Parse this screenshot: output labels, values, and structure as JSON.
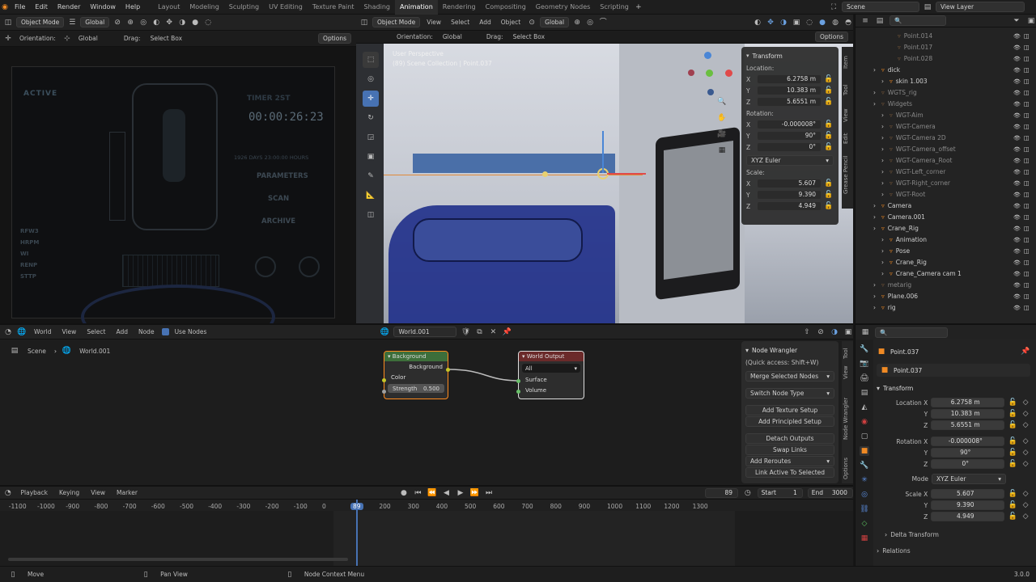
{
  "topbar": {
    "menus": [
      "File",
      "Edit",
      "Render",
      "Window",
      "Help"
    ],
    "workspaces": [
      "Layout",
      "Modeling",
      "Sculpting",
      "UV Editing",
      "Texture Paint",
      "Shading",
      "Animation",
      "Rendering",
      "Compositing",
      "Geometry Nodes",
      "Scripting"
    ],
    "active_workspace": "Animation",
    "scene": "Scene",
    "view_layer": "View Layer"
  },
  "left_viewport": {
    "mode": "Object Mode",
    "transform": "Global",
    "orientation_label": "Orientation:",
    "orientation": "Global",
    "drag_label": "Drag:",
    "drag": "Select Box",
    "options": "Options",
    "hud": {
      "timer_label": "TIMER 2ST",
      "timer": "00:00:26:23",
      "status": "ACTIVE",
      "days": "1926 DAYS 23:00:00 HOURS",
      "menu": [
        "PARAMETERS",
        "SCAN",
        "ARCHIVE"
      ],
      "stats": [
        "RFW3",
        "HRPM",
        "WI",
        "RENP",
        "STTP"
      ]
    }
  },
  "main_viewport": {
    "mode": "Object Mode",
    "menus": [
      "View",
      "Select",
      "Add",
      "Object"
    ],
    "transform": "Global",
    "orientation_label": "Orientation:",
    "orientation": "Global",
    "drag_label": "Drag:",
    "drag": "Select Box",
    "options": "Options",
    "view_name": "User Perspective",
    "collection": "(89) Scene Collection | Point.037"
  },
  "n_panel": {
    "title": "Transform",
    "location_label": "Location:",
    "location": {
      "x": "6.2758 m",
      "y": "10.383 m",
      "z": "5.6551 m"
    },
    "rotation_label": "Rotation:",
    "rotation": {
      "x": "-0.000008°",
      "y": "90°",
      "z": "0°"
    },
    "rotation_mode": "XYZ Euler",
    "scale_label": "Scale:",
    "scale": {
      "x": "5.607",
      "y": "9.390",
      "z": "4.949"
    },
    "tabs": [
      "Item",
      "Tool",
      "View",
      "Edit",
      "Grease Pencil"
    ]
  },
  "outliner": {
    "items": [
      {
        "label": "Point.014",
        "indent": 3,
        "dim": true
      },
      {
        "label": "Point.017",
        "indent": 3,
        "dim": true
      },
      {
        "label": "Point.028",
        "indent": 3,
        "dim": true
      },
      {
        "label": "dick",
        "indent": 1,
        "dim": false
      },
      {
        "label": "skin 1.003",
        "indent": 2,
        "dim": false
      },
      {
        "label": "WGTS_rig",
        "indent": 1,
        "dim": true
      },
      {
        "label": "Widgets",
        "indent": 1,
        "dim": true
      },
      {
        "label": "WGT-Aim",
        "indent": 2,
        "dim": true
      },
      {
        "label": "WGT-Camera",
        "indent": 2,
        "dim": true
      },
      {
        "label": "WGT-Camera 2D",
        "indent": 2,
        "dim": true
      },
      {
        "label": "WGT-Camera_offset",
        "indent": 2,
        "dim": true
      },
      {
        "label": "WGT-Camera_Root",
        "indent": 2,
        "dim": true
      },
      {
        "label": "WGT-Left_corner",
        "indent": 2,
        "dim": true
      },
      {
        "label": "WGT-Right_corner",
        "indent": 2,
        "dim": true
      },
      {
        "label": "WGT-Root",
        "indent": 2,
        "dim": true
      },
      {
        "label": "Camera",
        "indent": 1,
        "dim": false
      },
      {
        "label": "Camera.001",
        "indent": 1,
        "dim": false
      },
      {
        "label": "Crane_Rig",
        "indent": 1,
        "dim": false
      },
      {
        "label": "Animation",
        "indent": 2,
        "dim": false
      },
      {
        "label": "Pose",
        "indent": 2,
        "dim": false
      },
      {
        "label": "Crane_Rig",
        "indent": 2,
        "dim": false
      },
      {
        "label": "Crane_Camera cam 1",
        "indent": 2,
        "dim": false
      },
      {
        "label": "metarig",
        "indent": 1,
        "dim": true
      },
      {
        "label": "Plane.006",
        "indent": 1,
        "dim": false
      },
      {
        "label": "rig",
        "indent": 1,
        "dim": false
      }
    ]
  },
  "node_editor": {
    "editor": "World",
    "menus": [
      "View",
      "Select",
      "Add",
      "Node"
    ],
    "use_nodes": "Use Nodes",
    "world_name": "World.001",
    "breadcrumb": [
      "Scene",
      "World.001"
    ],
    "bg_node": {
      "title": "Background",
      "out": "Background",
      "color": "Color",
      "strength_label": "Strength",
      "strength": "0.500"
    },
    "out_node": {
      "title": "World Output",
      "target": "All",
      "surface": "Surface",
      "volume": "Volume"
    },
    "wrangler": {
      "title": "Node Wrangler",
      "hint": "(Quick access: Shift+W)",
      "merge": "Merge Selected Nodes",
      "switch": "Switch Node Type",
      "add_texture": "Add Texture Setup",
      "add_principled": "Add Principled Setup",
      "detach": "Detach Outputs",
      "swap": "Swap Links",
      "reroutes": "Add Reroutes",
      "link_active": "Link Active To Selected"
    },
    "tabs": [
      "Tool",
      "View",
      "Node Wrangler",
      "Options"
    ]
  },
  "properties": {
    "object": "Point.037",
    "object_data": "Point.037",
    "section": "Transform",
    "location_x_label": "Location X",
    "location": {
      "x": "6.2758 m",
      "y": "10.383 m",
      "z": "5.6551 m"
    },
    "rotation_x_label": "Rotation X",
    "rotation": {
      "x": "-0.000008°",
      "y": "90°",
      "z": "0°"
    },
    "mode_label": "Mode",
    "mode": "XYZ Euler",
    "scale_x_label": "Scale X",
    "scale": {
      "x": "5.607",
      "y": "9.390",
      "z": "4.949"
    },
    "delta": "Delta Transform",
    "relations": "Relations"
  },
  "timeline": {
    "menus": [
      "Playback",
      "Keying",
      "View",
      "Marker"
    ],
    "current_frame": "89",
    "start_label": "Start",
    "start": "1",
    "end_label": "End",
    "end": "3000",
    "ticks": [
      "-1100",
      "-1000",
      "-900",
      "-800",
      "-700",
      "-600",
      "-500",
      "-400",
      "-300",
      "-200",
      "-100",
      "0",
      "89",
      "200",
      "300",
      "400",
      "500",
      "600",
      "700",
      "800",
      "900",
      "1000",
      "1100",
      "1200",
      "1300"
    ]
  },
  "statusbar": {
    "move": "Move",
    "pan": "Pan View",
    "ctx": "Node Context Menu",
    "version": "3.0.0"
  },
  "colors": {
    "accent": "#4772b3",
    "orange": "#ff8b1e",
    "socket": "#c7c729"
  }
}
